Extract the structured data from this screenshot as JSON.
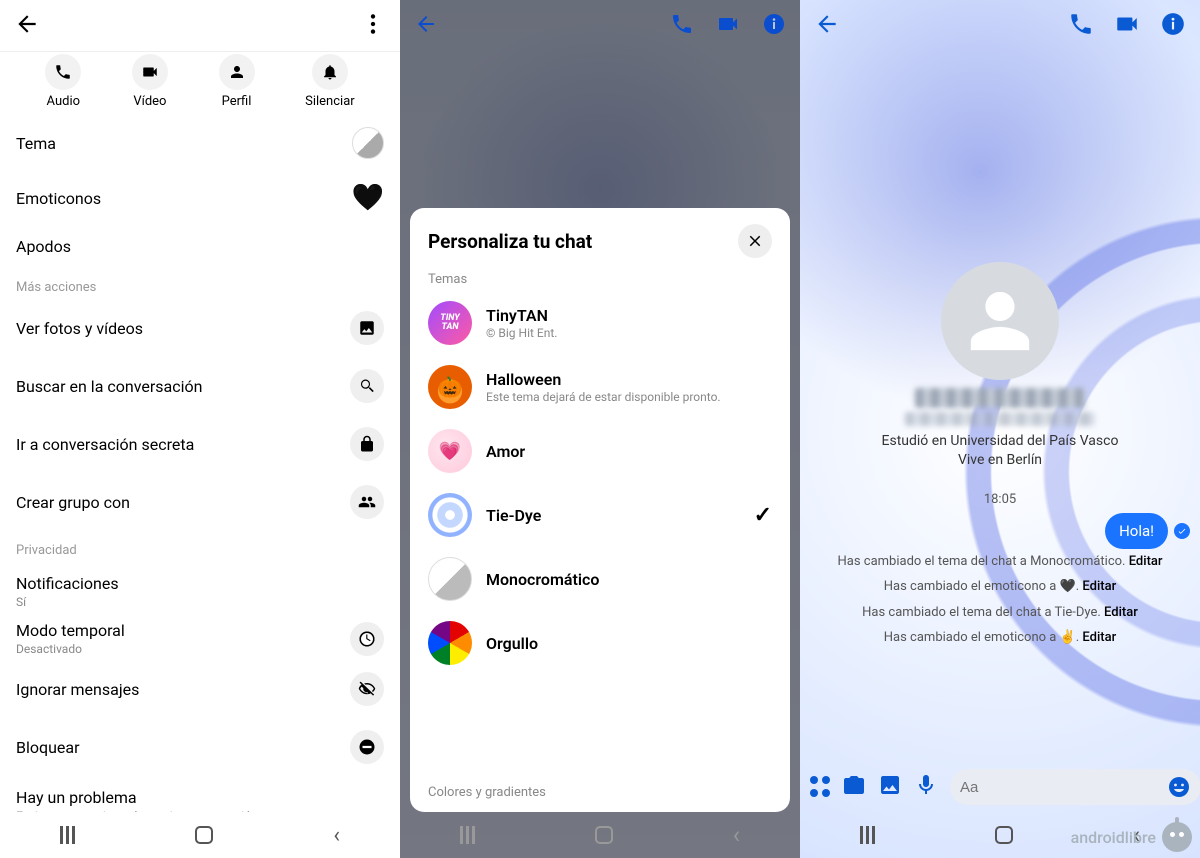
{
  "panel1": {
    "quick": {
      "audio": "Audio",
      "video": "Vídeo",
      "profile": "Perfil",
      "mute": "Silenciar"
    },
    "rows": {
      "theme": "Tema",
      "emoticons": "Emoticonos",
      "nick": "Apodos"
    },
    "sections": {
      "more": "Más acciones",
      "privacy": "Privacidad"
    },
    "more": {
      "photos": "Ver fotos y vídeos",
      "search": "Buscar en la conversación",
      "secret": "Ir a conversación secreta",
      "group": "Crear grupo con"
    },
    "privacy": {
      "notif": "Notificaciones",
      "notif_sub": "Sí",
      "temp": "Modo temporal",
      "temp_sub": "Desactivado",
      "ignore": "Ignorar mensajes",
      "block": "Bloquear",
      "problem": "Hay un problema",
      "problem_sub": "Enviar comentarios y denunciar conversación"
    },
    "heart": "🖤"
  },
  "panel2": {
    "title": "Personaliza tu chat",
    "section_themes": "Temas",
    "section_colors": "Colores y gradientes",
    "themes": {
      "t0": {
        "name": "TinyTAN",
        "desc": "© Big Hit Ent."
      },
      "t1": {
        "name": "Halloween",
        "desc": "Este tema dejará de estar disponible pronto."
      },
      "t2": {
        "name": "Amor"
      },
      "t3": {
        "name": "Tie-Dye",
        "selected": "✓"
      },
      "t4": {
        "name": "Monocromático"
      },
      "t5": {
        "name": "Orgullo"
      }
    }
  },
  "panel3": {
    "bio1": "Estudió en Universidad del País Vasco",
    "bio2": "Vive en Berlín",
    "time": "18:05",
    "msg": "Hola!",
    "sys1_a": "Has cambiado el tema del chat a Monocromático. ",
    "sys2_a": "Has cambiado el emoticono a 🖤. ",
    "sys3_a": "Has cambiado el tema del chat a Tie-Dye. ",
    "sys4_a": "Has cambiado el emoticono a ✌️. ",
    "edit": "Editar",
    "placeholder": "Aa",
    "hand": "✌️",
    "watermark": "androidlibre"
  }
}
